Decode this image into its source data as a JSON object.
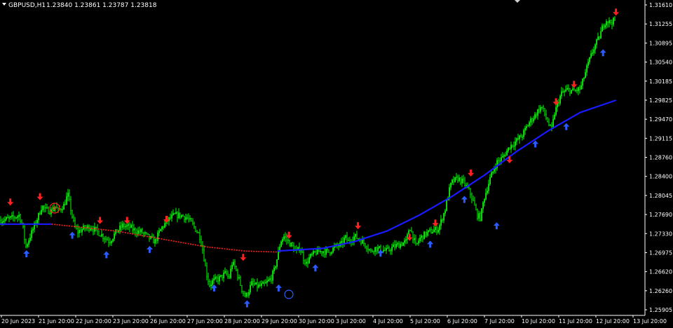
{
  "header": {
    "symbol": "GBPUSD,H1",
    "ohlc": "1.23840 1.23861 1.23787 1.23818"
  },
  "colors": {
    "background": "#000000",
    "axis": "#ffffff",
    "candles": "#00ff00",
    "ma_up": "#1a1aff",
    "ma_down": "#ff2020",
    "arrow_up": "#2a5cff",
    "arrow_down": "#ff2020"
  },
  "chart_data": {
    "type": "candlestick",
    "price_axis": {
      "ticks": [
        "1.31610",
        "1.31255",
        "1.30895",
        "1.30540",
        "1.30185",
        "1.29825",
        "1.29470",
        "1.29115",
        "1.28760",
        "1.28400",
        "1.28045",
        "1.27690",
        "1.27330",
        "1.26975",
        "1.26620",
        "1.26260",
        "1.25905"
      ],
      "ylim": [
        1.257,
        1.3168
      ]
    },
    "time_axis": {
      "ticks": [
        "20 Jun 2023",
        "21 Jun 20:00",
        "22 Jun 20:00",
        "23 Jun 20:00",
        "26 Jun 20:00",
        "27 Jun 20:00",
        "28 Jun 20:00",
        "29 Jun 20:00",
        "30 Jun 20:00",
        "3 Jul 20:00",
        "4 Jul 20:00",
        "5 Jul 20:00",
        "6 Jul 20:00",
        "7 Jul 20:00",
        "10 Jul 20:00",
        "11 Jul 20:00",
        "12 Jul 20:00",
        "13 Jul 20:00"
      ]
    },
    "price_path": [
      [
        0,
        1.275
      ],
      [
        0.01,
        1.2752
      ],
      [
        0.02,
        1.2755
      ],
      [
        0.03,
        1.276
      ],
      [
        0.035,
        1.274
      ],
      [
        0.04,
        1.27
      ],
      [
        0.05,
        1.273
      ],
      [
        0.06,
        1.276
      ],
      [
        0.065,
        1.2778
      ],
      [
        0.07,
        1.277
      ],
      [
        0.08,
        1.2768
      ],
      [
        0.085,
        1.2778
      ],
      [
        0.09,
        1.2768
      ],
      [
        0.1,
        1.278
      ],
      [
        0.105,
        1.28
      ],
      [
        0.11,
        1.277
      ],
      [
        0.115,
        1.274
      ],
      [
        0.12,
        1.2728
      ],
      [
        0.13,
        1.2735
      ],
      [
        0.14,
        1.2738
      ],
      [
        0.15,
        1.273
      ],
      [
        0.16,
        1.272
      ],
      [
        0.17,
        1.271
      ],
      [
        0.18,
        1.2728
      ],
      [
        0.19,
        1.274
      ],
      [
        0.2,
        1.2738
      ],
      [
        0.21,
        1.273
      ],
      [
        0.22,
        1.2728
      ],
      [
        0.23,
        1.2718
      ],
      [
        0.24,
        1.271
      ],
      [
        0.25,
        1.2735
      ],
      [
        0.26,
        1.275
      ],
      [
        0.27,
        1.276
      ],
      [
        0.28,
        1.276
      ],
      [
        0.29,
        1.2755
      ],
      [
        0.3,
        1.274
      ],
      [
        0.31,
        1.272
      ],
      [
        0.315,
        1.269
      ],
      [
        0.32,
        1.265
      ],
      [
        0.325,
        1.2628
      ],
      [
        0.33,
        1.2635
      ],
      [
        0.34,
        1.264
      ],
      [
        0.35,
        1.265
      ],
      [
        0.355,
        1.264
      ],
      [
        0.36,
        1.267
      ],
      [
        0.365,
        1.266
      ],
      [
        0.37,
        1.264
      ],
      [
        0.375,
        1.262
      ],
      [
        0.38,
        1.2605
      ],
      [
        0.385,
        1.2615
      ],
      [
        0.39,
        1.263
      ],
      [
        0.4,
        1.2625
      ],
      [
        0.41,
        1.2628
      ],
      [
        0.42,
        1.264
      ],
      [
        0.425,
        1.2655
      ],
      [
        0.43,
        1.268
      ],
      [
        0.435,
        1.271
      ],
      [
        0.44,
        1.272
      ],
      [
        0.45,
        1.2705
      ],
      [
        0.46,
        1.269
      ],
      [
        0.465,
        1.27
      ],
      [
        0.47,
        1.268
      ],
      [
        0.475,
        1.2668
      ],
      [
        0.48,
        1.268
      ],
      [
        0.49,
        1.269
      ],
      [
        0.5,
        1.2692
      ],
      [
        0.51,
        1.269
      ],
      [
        0.52,
        1.27
      ],
      [
        0.53,
        1.2705
      ],
      [
        0.535,
        1.2718
      ],
      [
        0.54,
        1.271
      ],
      [
        0.55,
        1.272
      ],
      [
        0.56,
        1.2712
      ],
      [
        0.57,
        1.27
      ],
      [
        0.575,
        1.269
      ],
      [
        0.58,
        1.2698
      ],
      [
        0.59,
        1.2695
      ],
      [
        0.6,
        1.2692
      ],
      [
        0.61,
        1.27
      ],
      [
        0.62,
        1.2705
      ],
      [
        0.63,
        1.271
      ],
      [
        0.635,
        1.274
      ],
      [
        0.64,
        1.272
      ],
      [
        0.645,
        1.27
      ],
      [
        0.65,
        1.2715
      ],
      [
        0.66,
        1.2725
      ],
      [
        0.67,
        1.273
      ],
      [
        0.68,
        1.2735
      ],
      [
        0.69,
        1.277
      ],
      [
        0.695,
        1.28
      ],
      [
        0.7,
        1.2822
      ],
      [
        0.71,
        1.283
      ],
      [
        0.72,
        1.282
      ],
      [
        0.73,
        1.28
      ],
      [
        0.735,
        1.278
      ],
      [
        0.74,
        1.276
      ],
      [
        0.745,
        1.2755
      ],
      [
        0.75,
        1.279
      ],
      [
        0.76,
        1.283
      ],
      [
        0.77,
        1.286
      ],
      [
        0.78,
        1.287
      ],
      [
        0.79,
        1.289
      ],
      [
        0.8,
        1.29
      ],
      [
        0.81,
        1.2912
      ],
      [
        0.82,
        1.2935
      ],
      [
        0.83,
        1.295
      ],
      [
        0.835,
        1.296
      ],
      [
        0.84,
        1.2965
      ],
      [
        0.845,
        1.295
      ],
      [
        0.85,
        1.2935
      ],
      [
        0.855,
        1.292
      ],
      [
        0.86,
        1.2955
      ],
      [
        0.87,
        1.299
      ],
      [
        0.88,
        1.2998
      ],
      [
        0.89,
        1.2995
      ],
      [
        0.9,
        1.3
      ],
      [
        0.91,
        1.304
      ],
      [
        0.92,
        1.3075
      ],
      [
        0.93,
        1.31
      ],
      [
        0.935,
        1.312
      ],
      [
        0.94,
        1.313
      ],
      [
        0.945,
        1.3125
      ],
      [
        0.955,
        1.313
      ]
    ],
    "moving_average": {
      "segments": [
        {
          "trend": "up",
          "color": "#1a1aff",
          "points": [
            [
              0,
              1.2743
            ],
            [
              0.08,
              1.2743
            ]
          ]
        },
        {
          "trend": "down",
          "color": "#ff2020",
          "points": [
            [
              0.08,
              1.2743
            ],
            [
              0.18,
              1.273
            ],
            [
              0.25,
              1.2715
            ],
            [
              0.32,
              1.27
            ],
            [
              0.38,
              1.2692
            ],
            [
              0.43,
              1.269
            ]
          ]
        },
        {
          "trend": "up",
          "color": "#1a1aff",
          "points": [
            [
              0.43,
              1.2692
            ],
            [
              0.5,
              1.2697
            ],
            [
              0.55,
              1.271
            ],
            [
              0.6,
              1.273
            ],
            [
              0.65,
              1.276
            ],
            [
              0.7,
              1.2795
            ],
            [
              0.75,
              1.2835
            ],
            [
              0.8,
              1.288
            ],
            [
              0.85,
              1.292
            ],
            [
              0.9,
              1.2955
            ],
            [
              0.955,
              1.2978
            ]
          ]
        }
      ]
    },
    "signals": [
      {
        "type": "sell",
        "t": 0.016,
        "p": 1.2785
      },
      {
        "type": "buy",
        "t": 0.041,
        "p": 1.2687
      },
      {
        "type": "sell",
        "t": 0.062,
        "p": 1.2795
      },
      {
        "type": "buy",
        "t": 0.112,
        "p": 1.2722
      },
      {
        "type": "sell",
        "t": 0.155,
        "p": 1.275
      },
      {
        "type": "buy",
        "t": 0.165,
        "p": 1.2685
      },
      {
        "type": "sell",
        "t": 0.197,
        "p": 1.275
      },
      {
        "type": "buy",
        "t": 0.232,
        "p": 1.2695
      },
      {
        "type": "sell",
        "t": 0.258,
        "p": 1.2752
      },
      {
        "type": "buy",
        "t": 0.332,
        "p": 1.2622
      },
      {
        "type": "sell",
        "t": 0.377,
        "p": 1.268
      },
      {
        "type": "buy",
        "t": 0.383,
        "p": 1.2592
      },
      {
        "type": "buy",
        "t": 0.432,
        "p": 1.2622
      },
      {
        "type": "sell",
        "t": 0.448,
        "p": 1.2722
      },
      {
        "type": "buy",
        "t": 0.489,
        "p": 1.266
      },
      {
        "type": "sell",
        "t": 0.555,
        "p": 1.274
      },
      {
        "type": "buy",
        "t": 0.59,
        "p": 1.2688
      },
      {
        "type": "sell",
        "t": 0.635,
        "p": 1.2718
      },
      {
        "type": "buy",
        "t": 0.667,
        "p": 1.2705
      },
      {
        "type": "sell",
        "t": 0.675,
        "p": 1.2745
      },
      {
        "type": "buy",
        "t": 0.72,
        "p": 1.279
      },
      {
        "type": "sell",
        "t": 0.73,
        "p": 1.284
      },
      {
        "type": "buy",
        "t": 0.77,
        "p": 1.274
      },
      {
        "type": "sell",
        "t": 0.79,
        "p": 1.2865
      },
      {
        "type": "buy",
        "t": 0.83,
        "p": 1.2895
      },
      {
        "type": "sell",
        "t": 0.862,
        "p": 1.2975
      },
      {
        "type": "buy",
        "t": 0.878,
        "p": 1.2928
      },
      {
        "type": "sell",
        "t": 0.89,
        "p": 1.3008
      },
      {
        "type": "buy",
        "t": 0.935,
        "p": 1.3068
      },
      {
        "type": "sell",
        "t": 0.955,
        "p": 1.3145
      }
    ]
  }
}
